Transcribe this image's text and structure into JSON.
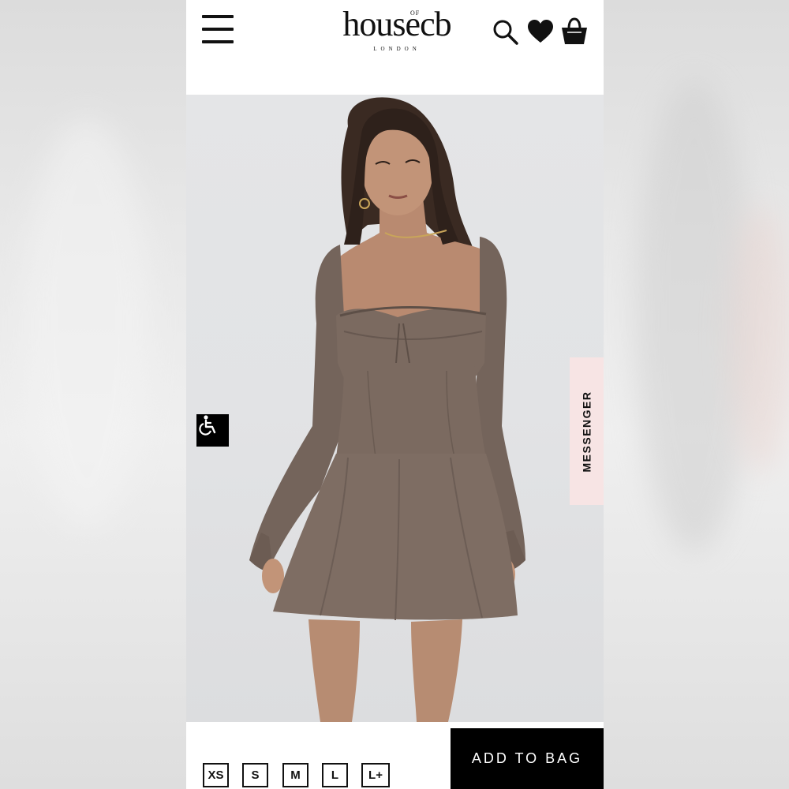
{
  "header": {
    "brand_main": "house",
    "brand_of": "OF",
    "brand_tail": "cb",
    "brand_sub": "LONDON",
    "icons": [
      "menu-icon",
      "search-icon",
      "heart-icon",
      "bag-icon"
    ]
  },
  "product": {
    "image_alt": "Model wearing long sleeve mini dress",
    "dress_color": "#7b6a60"
  },
  "widgets": {
    "accessibility_icon": "wheelchair-icon",
    "messenger_label": "MESSENGER",
    "messenger_color": "#f7e4e4"
  },
  "bottom": {
    "sizes": [
      "XS",
      "S",
      "M",
      "L",
      "L+"
    ],
    "add_to_bag_label": "ADD TO BAG"
  }
}
